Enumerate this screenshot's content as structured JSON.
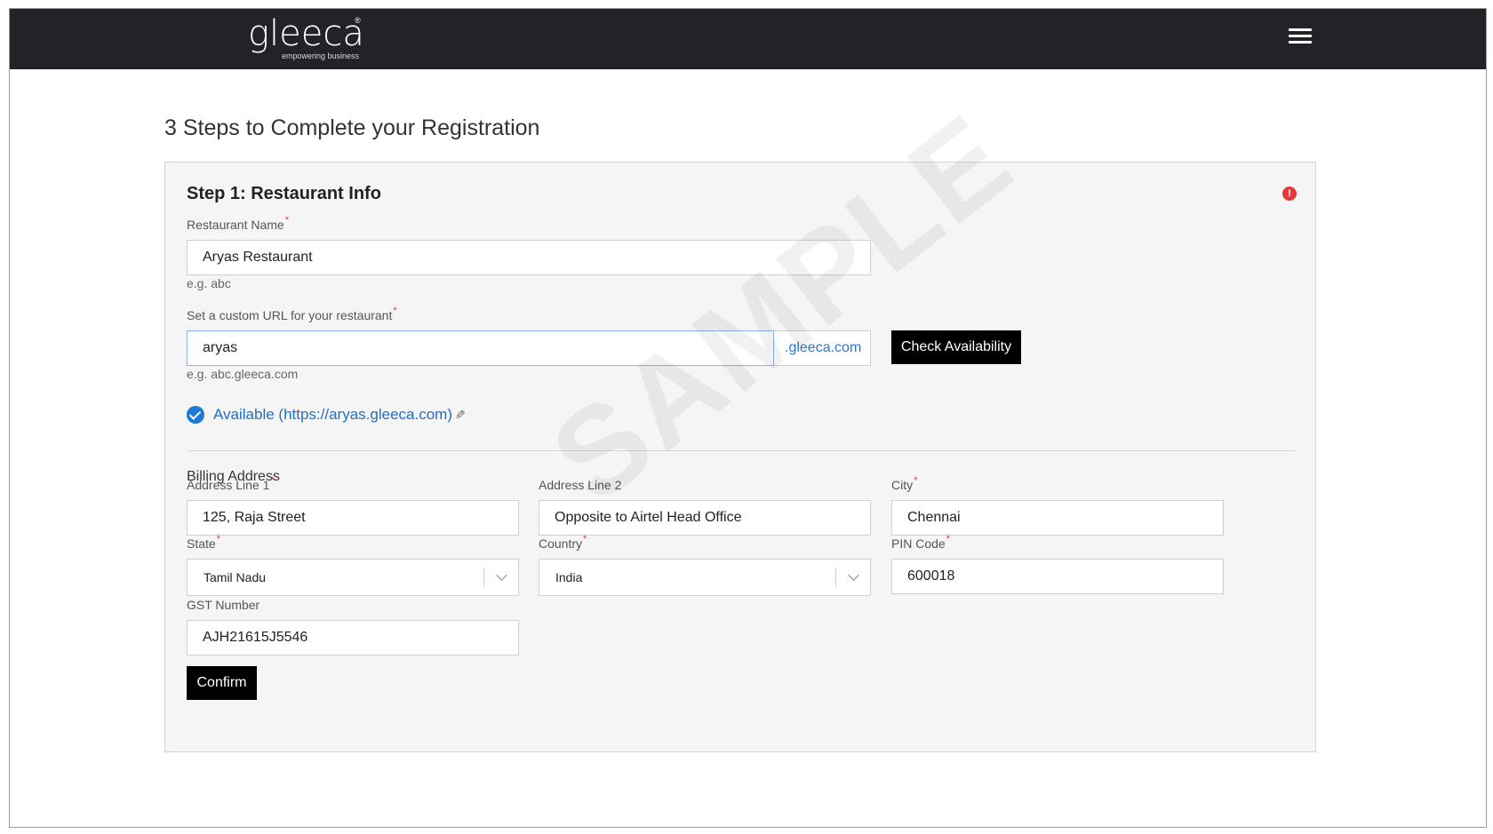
{
  "header": {
    "logo_text": "gleeca",
    "logo_registered": "®",
    "logo_tagline": "empowering business",
    "menu_icon": "hamburger-menu-icon"
  },
  "page": {
    "title": "3 Steps to Complete your Registration",
    "watermark": "SAMPLE"
  },
  "step1": {
    "title": "Step 1: Restaurant Info",
    "alert_icon": "!",
    "restaurant_name": {
      "label": "Restaurant Name",
      "required": "*",
      "value": "Aryas Restaurant",
      "hint": "e.g. abc"
    },
    "custom_url": {
      "label": "Set a custom URL for your restaurant",
      "required": "*",
      "value": "aryas",
      "suffix": ".gleeca.com",
      "hint": "e.g. abc.gleeca.com",
      "check_button": "Check Availability",
      "availability_text": "Available (https://aryas.gleeca.com)"
    }
  },
  "billing": {
    "title": "Billing Address",
    "address_line1": {
      "label": "Address Line 1",
      "required": "*",
      "value": "125, Raja Street"
    },
    "address_line2": {
      "label": "Address Line 2",
      "value": "Opposite to Airtel Head Office"
    },
    "city": {
      "label": "City",
      "required": "*",
      "value": "Chennai"
    },
    "state": {
      "label": "State",
      "required": "*",
      "value": "Tamil Nadu"
    },
    "country": {
      "label": "Country",
      "required": "*",
      "value": "India"
    },
    "pin_code": {
      "label": "PIN Code",
      "required": "*",
      "value": "600018"
    },
    "gst_number": {
      "label": "GST Number",
      "value": "AJH21615J5546"
    },
    "confirm_button": "Confirm"
  },
  "colors": {
    "header_bg": "#222326",
    "link_blue": "#1f6fc5",
    "required_red": "#e5383b",
    "button_black": "#000000"
  }
}
